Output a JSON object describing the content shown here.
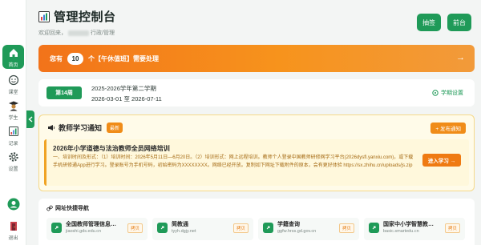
{
  "header": {
    "title": "管理控制台",
    "subtitle_prefix": "欢迎回来",
    "subtitle_suffix": "行政/管理",
    "btn_signin": "抽签",
    "btn_desk": "前台"
  },
  "sidebar": {
    "items": [
      {
        "label": "首页",
        "icon": "home-icon"
      },
      {
        "label": "课堂",
        "icon": "smile-icon"
      },
      {
        "label": "学生",
        "icon": "student-icon"
      },
      {
        "label": "记录",
        "icon": "chart-icon"
      },
      {
        "label": "设置",
        "icon": "gear-icon"
      },
      {
        "label": "",
        "icon": "avatar-icon"
      },
      {
        "label": "退出",
        "icon": "exit-icon"
      }
    ]
  },
  "notice": {
    "prefix": "您有",
    "count": "10",
    "suffix": "个【午休值班】需要处理",
    "arrow": "→"
  },
  "semester": {
    "week": "第14周",
    "name": "2025-2026学年第二学期",
    "dates": "2026-03-01 至 2026-07-11",
    "setting": "学期设置"
  },
  "teacher_notice": {
    "title": "教师学习通知",
    "badge": "最新",
    "post_button": "+ 发布通知",
    "item_title": "2026年小学道德与法治教师全员网络培训",
    "item_body": "一、培训时间及形式：（1）培训时间：2026年5月11日—6月20日。（2）培训形式：网上远程培训。教师个人登录中国教师研修网学习平台(2026dysfl.yanxiu.com)，或下载手机研修通App进行学习。登录账号为手机号码，初始密码为XXXXXXXX。网络已经开放。复制如下网址下载附件的原本，会有更好体验 https://sx.zhihu.cn/uploads/js.zip",
    "join_button": "进入学习 →"
  },
  "quick_nav": {
    "title": "网址快捷导航",
    "copy_label": "拷贝",
    "items": [
      {
        "name": "全国教师管理信息系统",
        "url": "jiaoshi.gds.edu.cn"
      },
      {
        "name": "简教通",
        "url": "tyyh.dgjy.net"
      },
      {
        "name": "学籍查询",
        "url": "ggfw.hrss.gd.gov.cn"
      },
      {
        "name": "国家中小学智慧教育平台",
        "url": "basic.smartedu.cn"
      }
    ]
  },
  "colors": {
    "primary": "#1f9a58",
    "notice_orange": "#f7931c",
    "warning_yellow": "#fffbe9"
  }
}
